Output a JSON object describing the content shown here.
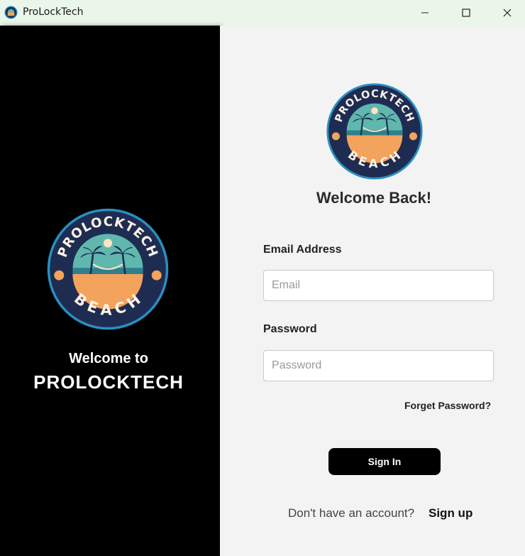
{
  "window": {
    "title": "ProLockTech",
    "controls": [
      "minimize-icon",
      "maximize-icon",
      "close-icon"
    ]
  },
  "left_panel": {
    "welcome_line": "Welcome to",
    "brand": "PROLOCKTECH",
    "logo": {
      "top_text": "PROLOCKTECH",
      "bottom_text": "BEACH"
    }
  },
  "right_panel": {
    "logo": {
      "top_text": "PROLOCKTECH",
      "bottom_text": "BEACH"
    },
    "heading": "Welcome Back!",
    "email": {
      "label": "Email Address",
      "placeholder": "Email",
      "value": ""
    },
    "password": {
      "label": "Password",
      "placeholder": "Password",
      "value": ""
    },
    "forgot_label": "Forget Password?",
    "signin_label": "Sign In",
    "no_account_text": "Don't have an account?",
    "signup_label": "Sign up"
  },
  "colors": {
    "titlebar_bg": "#eaf6e9",
    "left_bg": "#000000",
    "right_bg": "#f3f3f3",
    "logo_navy": "#1f2c52",
    "logo_ring": "#2a8fc0",
    "logo_sand": "#f4a35c",
    "logo_sea": "#5fb7ad"
  }
}
